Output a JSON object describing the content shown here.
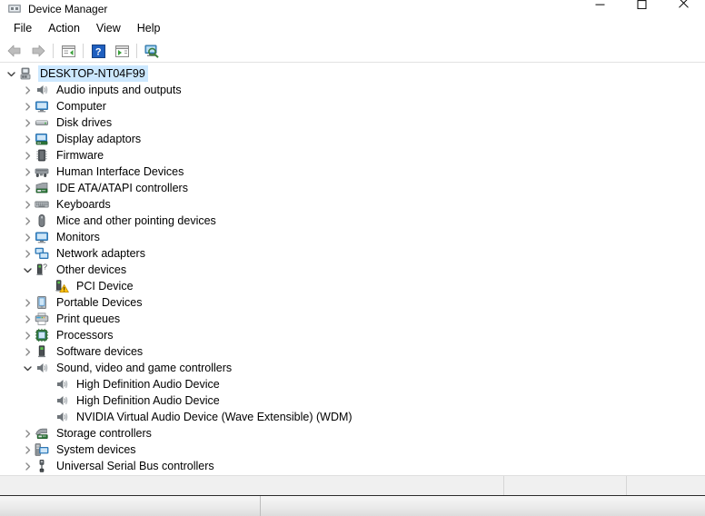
{
  "window": {
    "title": "Device Manager",
    "title_icon": "device-manager-icon",
    "controls": {
      "minimize": "Minimize",
      "maximize": "Maximize",
      "close": "Close"
    }
  },
  "menubar": {
    "items": [
      {
        "label": "File",
        "name": "menu-file"
      },
      {
        "label": "Action",
        "name": "menu-action"
      },
      {
        "label": "View",
        "name": "menu-view"
      },
      {
        "label": "Help",
        "name": "menu-help"
      }
    ]
  },
  "toolbar": {
    "buttons": [
      {
        "name": "back-button",
        "icon": "back-arrow-icon",
        "tooltip": "Back"
      },
      {
        "name": "forward-button",
        "icon": "forward-arrow-icon",
        "tooltip": "Forward"
      },
      {
        "name": "show-hide-console-tree-button",
        "icon": "console-tree-icon",
        "tooltip": "Show/Hide Console Tree"
      },
      {
        "name": "help-button",
        "icon": "help-question-icon",
        "tooltip": "Help"
      },
      {
        "name": "properties-button",
        "icon": "properties-icon",
        "tooltip": "Properties"
      },
      {
        "name": "scan-hardware-changes-button",
        "icon": "scan-monitor-icon",
        "tooltip": "Scan for hardware changes"
      }
    ]
  },
  "tree": {
    "root": {
      "label": "DESKTOP-NT04F99",
      "icon": "computer-node-icon",
      "expanded": true,
      "selected": true
    },
    "nodes": [
      {
        "label": "Audio inputs and outputs",
        "icon": "speaker-icon",
        "expandable": true,
        "expanded": false,
        "level": 1
      },
      {
        "label": "Computer",
        "icon": "monitor-icon",
        "expandable": true,
        "expanded": false,
        "level": 1
      },
      {
        "label": "Disk drives",
        "icon": "disk-drive-icon",
        "expandable": true,
        "expanded": false,
        "level": 1
      },
      {
        "label": "Display adaptors",
        "icon": "display-adapter-icon",
        "expandable": true,
        "expanded": false,
        "level": 1
      },
      {
        "label": "Firmware",
        "icon": "firmware-chip-icon",
        "expandable": true,
        "expanded": false,
        "level": 1
      },
      {
        "label": "Human Interface Devices",
        "icon": "hid-icon",
        "expandable": true,
        "expanded": false,
        "level": 1
      },
      {
        "label": "IDE ATA/ATAPI controllers",
        "icon": "ide-controller-icon",
        "expandable": true,
        "expanded": false,
        "level": 1
      },
      {
        "label": "Keyboards",
        "icon": "keyboard-icon",
        "expandable": true,
        "expanded": false,
        "level": 1
      },
      {
        "label": "Mice and other pointing devices",
        "icon": "mouse-icon",
        "expandable": true,
        "expanded": false,
        "level": 1
      },
      {
        "label": "Monitors",
        "icon": "monitor-icon",
        "expandable": true,
        "expanded": false,
        "level": 1
      },
      {
        "label": "Network adapters",
        "icon": "network-adapter-icon",
        "expandable": true,
        "expanded": false,
        "level": 1
      },
      {
        "label": "Other devices",
        "icon": "other-device-icon",
        "expandable": true,
        "expanded": true,
        "level": 1
      },
      {
        "label": "PCI Device",
        "icon": "other-device-warning-icon",
        "expandable": false,
        "expanded": false,
        "level": 2,
        "warning": true
      },
      {
        "label": "Portable Devices",
        "icon": "portable-device-icon",
        "expandable": true,
        "expanded": false,
        "level": 1
      },
      {
        "label": "Print queues",
        "icon": "printer-icon",
        "expandable": true,
        "expanded": false,
        "level": 1
      },
      {
        "label": "Processors",
        "icon": "processor-icon",
        "expandable": true,
        "expanded": false,
        "level": 1
      },
      {
        "label": "Software devices",
        "icon": "software-device-icon",
        "expandable": true,
        "expanded": false,
        "level": 1
      },
      {
        "label": "Sound, video and game controllers",
        "icon": "speaker-icon",
        "expandable": true,
        "expanded": true,
        "level": 1
      },
      {
        "label": "High Definition Audio Device",
        "icon": "speaker-icon",
        "expandable": false,
        "expanded": false,
        "level": 2
      },
      {
        "label": "High Definition Audio Device",
        "icon": "speaker-icon",
        "expandable": false,
        "expanded": false,
        "level": 2
      },
      {
        "label": "NVIDIA Virtual Audio Device (Wave Extensible) (WDM)",
        "icon": "speaker-icon",
        "expandable": false,
        "expanded": false,
        "level": 2
      },
      {
        "label": "Storage controllers",
        "icon": "storage-controller-icon",
        "expandable": true,
        "expanded": false,
        "level": 1
      },
      {
        "label": "System devices",
        "icon": "system-device-icon",
        "expandable": true,
        "expanded": false,
        "level": 1
      },
      {
        "label": "Universal Serial Bus controllers",
        "icon": "usb-icon",
        "expandable": true,
        "expanded": false,
        "level": 1
      }
    ]
  },
  "statusbar": {
    "panes": [
      {
        "text": "",
        "name": "status-pane-main"
      },
      {
        "text": "",
        "name": "status-pane-secondary"
      },
      {
        "text": "",
        "name": "status-pane-tertiary"
      }
    ]
  },
  "colors": {
    "selection": "#cce8ff",
    "window_bg": "#ffffff",
    "statusbar_bg": "#f0f0f0",
    "warning": "#ffc20e",
    "accent_blue": "#3c8fd4"
  }
}
